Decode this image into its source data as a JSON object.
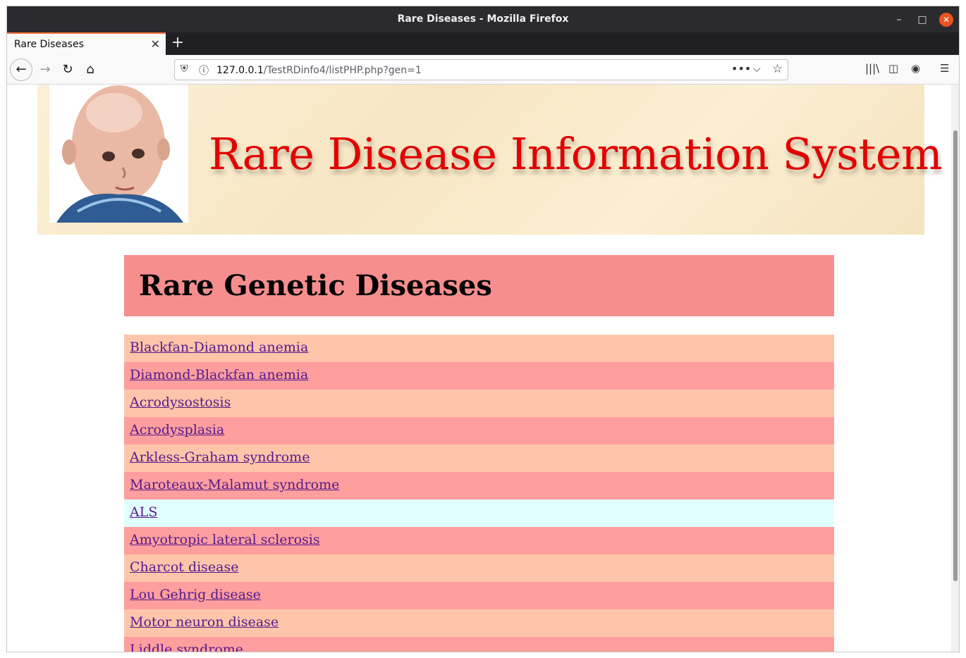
{
  "window": {
    "title": "Rare Diseases - Mozilla Firefox"
  },
  "tab": {
    "label": "Rare Diseases"
  },
  "urlbar": {
    "host": "127.0.0.1",
    "path": "/TestRDinfo4/listPHP.php?gen=1"
  },
  "banner": {
    "title": "Rare Disease Information System"
  },
  "heading": "Rare Genetic Diseases",
  "diseases": [
    {
      "label": "Blackfan-Diamond anemia",
      "color": "#ffc5aa"
    },
    {
      "label": "Diamond-Blackfan anemia",
      "color": "#ff9e9e"
    },
    {
      "label": "Acrodysostosis",
      "color": "#ffc5aa"
    },
    {
      "label": "Acrodysplasia",
      "color": "#ff9e9e"
    },
    {
      "label": "Arkless-Graham syndrome",
      "color": "#ffc5aa"
    },
    {
      "label": "Maroteaux-Malamut syndrome",
      "color": "#ff9e9e"
    },
    {
      "label": "ALS",
      "color": "#e0ffff"
    },
    {
      "label": "Amyotropic lateral sclerosis",
      "color": "#ff9e9e"
    },
    {
      "label": "Charcot disease",
      "color": "#ffc5aa"
    },
    {
      "label": "Lou Gehrig disease",
      "color": "#ff9e9e"
    },
    {
      "label": "Motor neuron disease",
      "color": "#ffc5aa"
    },
    {
      "label": "Liddle syndrome",
      "color": "#ff9e9e"
    }
  ],
  "colors": {
    "heading_bg": "#f78e8e",
    "banner_title": "#e10000",
    "link": "#551a8b"
  }
}
